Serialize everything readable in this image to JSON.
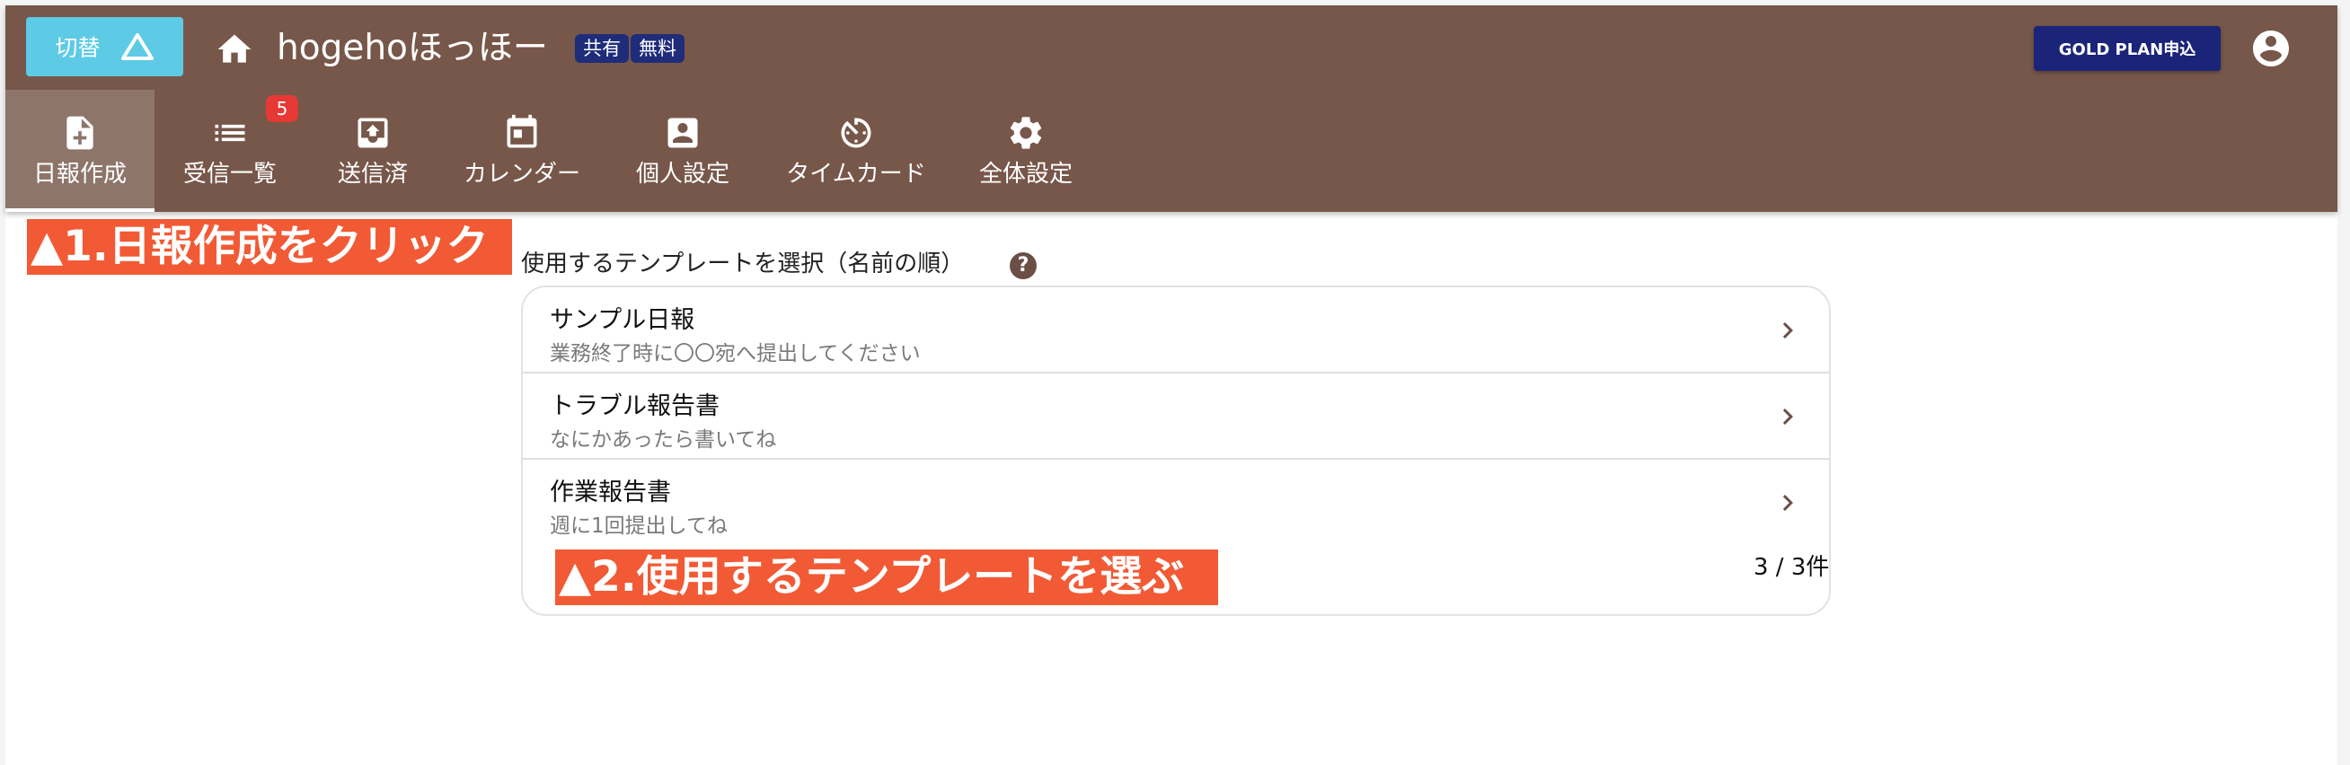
{
  "header": {
    "switch_label": "切替",
    "org_name": "hogehoほっほー",
    "badges": [
      "共有",
      "無料"
    ],
    "gold_plan_label": "GOLD PLAN申込"
  },
  "tabs": [
    {
      "label": "日報作成",
      "icon": "note-add-icon",
      "active": true
    },
    {
      "label": "受信一覧",
      "icon": "list-icon",
      "badge": "5"
    },
    {
      "label": "送信済",
      "icon": "outbox-icon"
    },
    {
      "label": "カレンダー",
      "icon": "calendar-icon"
    },
    {
      "label": "個人設定",
      "icon": "person-box-icon"
    },
    {
      "label": "タイムカード",
      "icon": "timer-icon"
    },
    {
      "label": "全体設定",
      "icon": "gear-icon"
    }
  ],
  "annotations": {
    "step1": "▲1.日報作成をクリック",
    "step2": "▲2.使用するテンプレートを選ぶ"
  },
  "template_section": {
    "title": "使用するテンプレートを選択（名前の順）",
    "help": "?",
    "items": [
      {
        "name": "サンプル日報",
        "description": "業務終了時に〇〇宛へ提出してください"
      },
      {
        "name": "トラブル報告書",
        "description": "なにかあったら書いてね"
      },
      {
        "name": "作業報告書",
        "description": "週に1回提出してね"
      }
    ],
    "pager": "3 / 3件"
  },
  "colors": {
    "appbar": "#77574a",
    "active_tab": "#8e756a",
    "switch_button": "#5ecbe6",
    "gold_button": "#1a2478",
    "callout": "#f15a35",
    "badge": "#1f2c7a"
  }
}
